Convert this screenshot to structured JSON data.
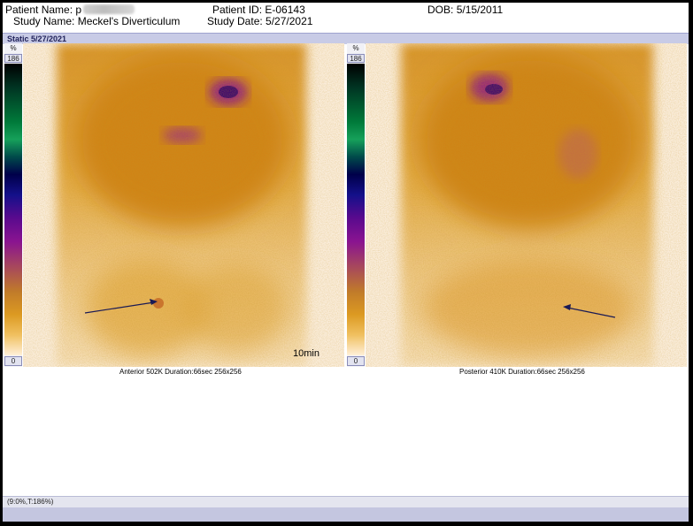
{
  "header": {
    "patient_name_label": "Patient Name:",
    "patient_name_visible": "p",
    "patient_id_label": "Patient ID:",
    "patient_id": "E-06143",
    "dob_label": "DOB:",
    "dob": "5/15/2011",
    "study_name_label": "Study Name:",
    "study_name": "Meckel's Diverticulum",
    "study_date_label": "Study Date:",
    "study_date": "5/27/2021"
  },
  "series": {
    "label": "Static 5/27/2021"
  },
  "colorbar": {
    "unit": "%",
    "max": "186",
    "min": "0"
  },
  "views": [
    {
      "caption": "Anterior 502K Duration:66sec 256x256",
      "time_label": "10min"
    },
    {
      "caption": "Posterior 410K Duration:66sec 256x256"
    }
  ],
  "status": {
    "text": "(9:0%,T:186%)"
  },
  "colors": {
    "hot_orange": "#dc9a22",
    "low_uptake": "#f6e2be",
    "purple_uptake": "#8a1490",
    "series_bar": "#c8cbe6",
    "arrow": "#1a1a55"
  },
  "icons": {
    "arrow": "arrow-annotation-icon"
  }
}
